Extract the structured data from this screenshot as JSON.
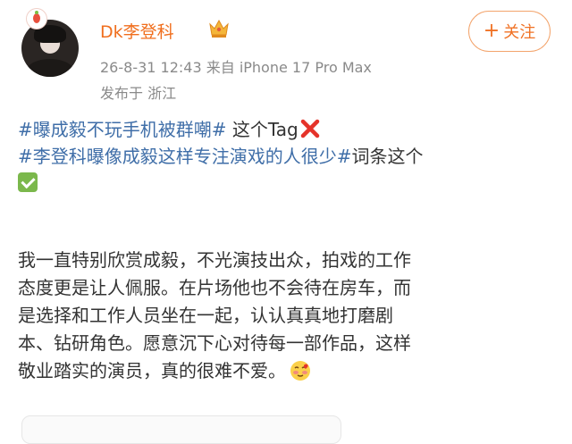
{
  "post": {
    "username": "Dk李登科",
    "meta": "26-8-31 12:43  来自 iPhone 17 Pro Max",
    "location": "发布于 浙江",
    "follow_label": "关注",
    "follow_plus": "+",
    "tag1": "#曝成毅不玩手机被群嘲#",
    "tag1_suffix": " 这个Tag",
    "tag2": "#李登科曝像成毅这样专注演戏的人很少#",
    "tag2_suffix": "词条这个",
    "body_lines": [
      "我一直特别欣赏成毅，不光演技出众，拍戏的工作",
      "态度更是让人佩服。在片场他也不会待在房车，而",
      "是选择和工作人员坐在一起，认认真真地打磨剧",
      "本、钻研角色。愿意沉下心对待每一部作品，这样",
      "敬业踏实的演员，真的很难不爱。"
    ]
  },
  "icons": {
    "avatar_badge": "app-badge-icon",
    "crown": "crown-icon",
    "cross": "red-cross-emoji",
    "check": "green-check-emoji",
    "blush": "blushing-face-emoji"
  }
}
